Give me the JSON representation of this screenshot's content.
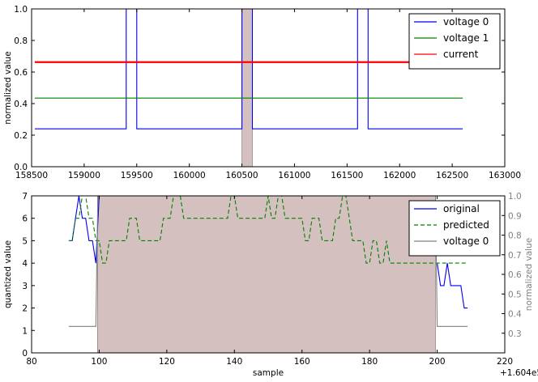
{
  "chart_data": [
    {
      "type": "line",
      "ylabel": "normalized value",
      "xlim": [
        158500,
        163000
      ],
      "ylim": [
        0,
        1.0
      ],
      "x_ticks": [
        158500,
        159000,
        159500,
        160000,
        160500,
        161000,
        161500,
        162000,
        162500,
        163000
      ],
      "y_ticks": [
        0.0,
        0.2,
        0.4,
        0.6,
        0.8,
        1.0
      ],
      "shaded_region": {
        "from": 160500,
        "to": 160600,
        "color": "#b38d8d"
      },
      "legend_position": "top-right",
      "series": [
        {
          "name": "voltage 0",
          "color": "#0000ee",
          "baseline": 0.24,
          "pulses": [
            [
              159400,
              159500
            ],
            [
              160500,
              160600
            ],
            [
              161600,
              161700
            ]
          ],
          "x_range": [
            158530,
            162600
          ],
          "pulse_value": 1.0
        },
        {
          "name": "voltage 1",
          "color": "#008000",
          "value": 0.435,
          "x_range": [
            158530,
            162600
          ]
        },
        {
          "name": "current",
          "color": "#ff0000",
          "value": 0.663,
          "x_range": [
            158530,
            162600
          ]
        }
      ]
    },
    {
      "type": "line",
      "xlabel": "sample",
      "ylabel": "quantized value",
      "ylabel_right": "normalized value",
      "offset_label": "+1.604e5",
      "xlim": [
        80,
        220
      ],
      "ylim": [
        0,
        7
      ],
      "ylim_right": [
        0.2,
        1.0
      ],
      "x_ticks": [
        80,
        100,
        120,
        140,
        160,
        180,
        200,
        220
      ],
      "y_ticks": [
        0,
        1,
        2,
        3,
        4,
        5,
        6,
        7
      ],
      "y_ticks_right": [
        0.3,
        0.4,
        0.5,
        0.6,
        0.7,
        0.8,
        0.9,
        1.0
      ],
      "shaded_region": {
        "from": 99.5,
        "to": 199.5,
        "color": "#b38d8d"
      },
      "legend_position": "top-right",
      "series": [
        {
          "name": "original",
          "color": "#0000ee",
          "axis": "left",
          "x": [
            91,
            92,
            93,
            94,
            95,
            96,
            97,
            98,
            99,
            100,
            200,
            201,
            202,
            203,
            204,
            205,
            206,
            207,
            208,
            209
          ],
          "y": [
            5,
            5,
            6,
            7,
            6,
            6,
            5,
            5,
            4,
            7,
            4,
            3,
            3,
            4,
            3,
            3,
            3,
            3,
            2,
            2
          ]
        },
        {
          "name": "predicted",
          "color": "#008000",
          "dashed": true,
          "axis": "left",
          "x": [
            91,
            92,
            93,
            94,
            95,
            96,
            97,
            98,
            99,
            100,
            101,
            102,
            103,
            104,
            105,
            106,
            107,
            108,
            109,
            110,
            111,
            112,
            113,
            114,
            115,
            116,
            117,
            118,
            119,
            120,
            121,
            122,
            123,
            124,
            125,
            126,
            127,
            128,
            129,
            130,
            131,
            132,
            133,
            134,
            135,
            136,
            137,
            138,
            139,
            140,
            141,
            142,
            143,
            144,
            145,
            146,
            147,
            148,
            149,
            150,
            151,
            152,
            153,
            154,
            155,
            156,
            157,
            158,
            159,
            160,
            161,
            162,
            163,
            164,
            165,
            166,
            167,
            168,
            169,
            170,
            171,
            172,
            173,
            174,
            175,
            176,
            177,
            178,
            179,
            180,
            181,
            182,
            183,
            184,
            185,
            186,
            187,
            188,
            189,
            190,
            191,
            192,
            193,
            194,
            195,
            196,
            197,
            198,
            199,
            200,
            201,
            202,
            203,
            204,
            205,
            206,
            207,
            208,
            209
          ],
          "y": [
            5,
            5,
            6,
            6,
            7,
            7,
            6,
            6,
            5,
            5,
            4,
            4,
            5,
            5,
            5,
            5,
            5,
            5,
            6,
            6,
            6,
            5,
            5,
            5,
            5,
            5,
            5,
            5,
            6,
            6,
            6,
            7,
            7,
            7,
            6,
            6,
            6,
            6,
            6,
            6,
            6,
            6,
            6,
            6,
            6,
            6,
            6,
            6,
            7,
            7,
            6,
            6,
            6,
            6,
            6,
            6,
            6,
            6,
            6,
            7,
            6,
            6,
            7,
            7,
            6,
            6,
            6,
            6,
            6,
            6,
            5,
            5,
            6,
            6,
            6,
            5,
            5,
            5,
            5,
            6,
            6,
            7,
            7,
            6,
            5,
            5,
            5,
            5,
            4,
            4,
            5,
            5,
            4,
            4,
            5,
            4,
            4,
            4,
            4,
            4,
            4,
            4,
            4,
            4,
            4,
            4,
            4,
            4,
            4,
            4,
            4,
            4,
            4,
            4,
            4,
            4,
            4,
            4,
            4
          ]
        },
        {
          "name": "voltage 0",
          "color": "#808080",
          "axis": "right",
          "x": [
            91,
            99,
            99.6,
            199.5,
            200,
            209
          ],
          "y": [
            0.335,
            0.335,
            1.0,
            1.0,
            0.335,
            0.335
          ]
        }
      ]
    }
  ]
}
